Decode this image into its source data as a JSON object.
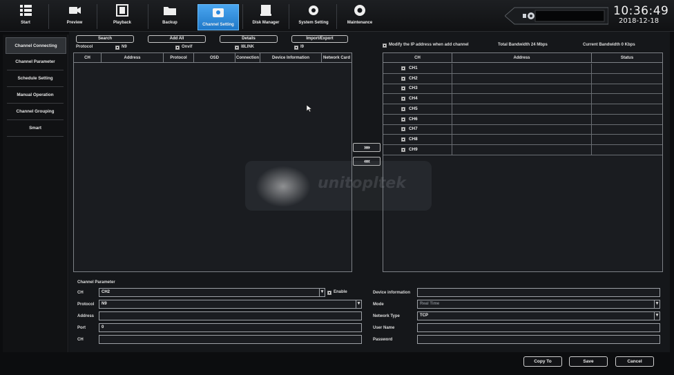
{
  "nav": {
    "items": [
      {
        "label": "Start",
        "icon": "menu-icon"
      },
      {
        "label": "Preview",
        "icon": "camera-icon"
      },
      {
        "label": "Playback",
        "icon": "film-icon"
      },
      {
        "label": "Backup",
        "icon": "folder-icon"
      },
      {
        "label": "Channel Setting",
        "icon": "channel-settings-icon"
      },
      {
        "label": "Disk Manager",
        "icon": "disk-icon"
      },
      {
        "label": "System Setting",
        "icon": "system-gear-icon"
      },
      {
        "label": "Maintenance",
        "icon": "gear-icon"
      }
    ],
    "active_index": 4,
    "accent_color": "#2b8ae0"
  },
  "clock": {
    "time": "10:36:49",
    "date": "2018-12-18"
  },
  "sidebar": {
    "items": [
      {
        "label": "Channel Connecting"
      },
      {
        "label": "Channel Parameter"
      },
      {
        "label": "Schedule Setting"
      },
      {
        "label": "Manual Operation"
      },
      {
        "label": "Channel Grouping"
      },
      {
        "label": "Smart"
      }
    ]
  },
  "left_panel": {
    "buttons": {
      "search": "Search",
      "add_all": "Add All",
      "details": "Details",
      "import_export": "Import/Export"
    },
    "protocol_label": "Protocol",
    "protocols": [
      {
        "label": "N9",
        "checked": true
      },
      {
        "label": "Onvif",
        "checked": true
      },
      {
        "label": "I8LINK",
        "checked": true
      },
      {
        "label": "I9",
        "checked": true
      }
    ],
    "columns": [
      "CH",
      "Address",
      "Protocol",
      "OSD",
      "Connection",
      "Device Information",
      "Network Card"
    ]
  },
  "right_panel": {
    "modify_ip_label": "Modify the IP address when add channel",
    "total_bandwidth": "Total Bandwidth  24 Mbps",
    "current_bandwidth": "Current Bandwidth  0 Kbps",
    "columns": [
      "CH",
      "Address",
      "Status"
    ],
    "channels": [
      {
        "name": "CH1"
      },
      {
        "name": "CH2"
      },
      {
        "name": "CH3"
      },
      {
        "name": "CH4"
      },
      {
        "name": "CH5"
      },
      {
        "name": "CH6"
      },
      {
        "name": "CH7"
      },
      {
        "name": "CH8"
      },
      {
        "name": "CH9"
      }
    ]
  },
  "transfer": {
    "add": "»»",
    "remove": "««"
  },
  "channel_parameter": {
    "title": "Channel Parameter",
    "ch_label": "CH",
    "ch_value": "CH2",
    "enable_label": "Enable",
    "protocol_label": "Protocol",
    "protocol_value": "N9",
    "address_label": "Address",
    "address_value": "",
    "port_label": "Port",
    "port_value": "0",
    "ch2_label": "CH",
    "ch2_value": "",
    "device_info_label": "Device information",
    "device_info_value": "",
    "mode_label": "Mode",
    "mode_value": "Real Time",
    "network_type_label": "Network Type",
    "network_type_value": "TCP",
    "user_name_label": "User Name",
    "user_name_value": "",
    "password_label": "Password",
    "password_value": ""
  },
  "footer": {
    "copy_to": "Copy To",
    "save": "Save",
    "cancel": "Cancel"
  },
  "watermark": {
    "text": "unitopltek"
  }
}
